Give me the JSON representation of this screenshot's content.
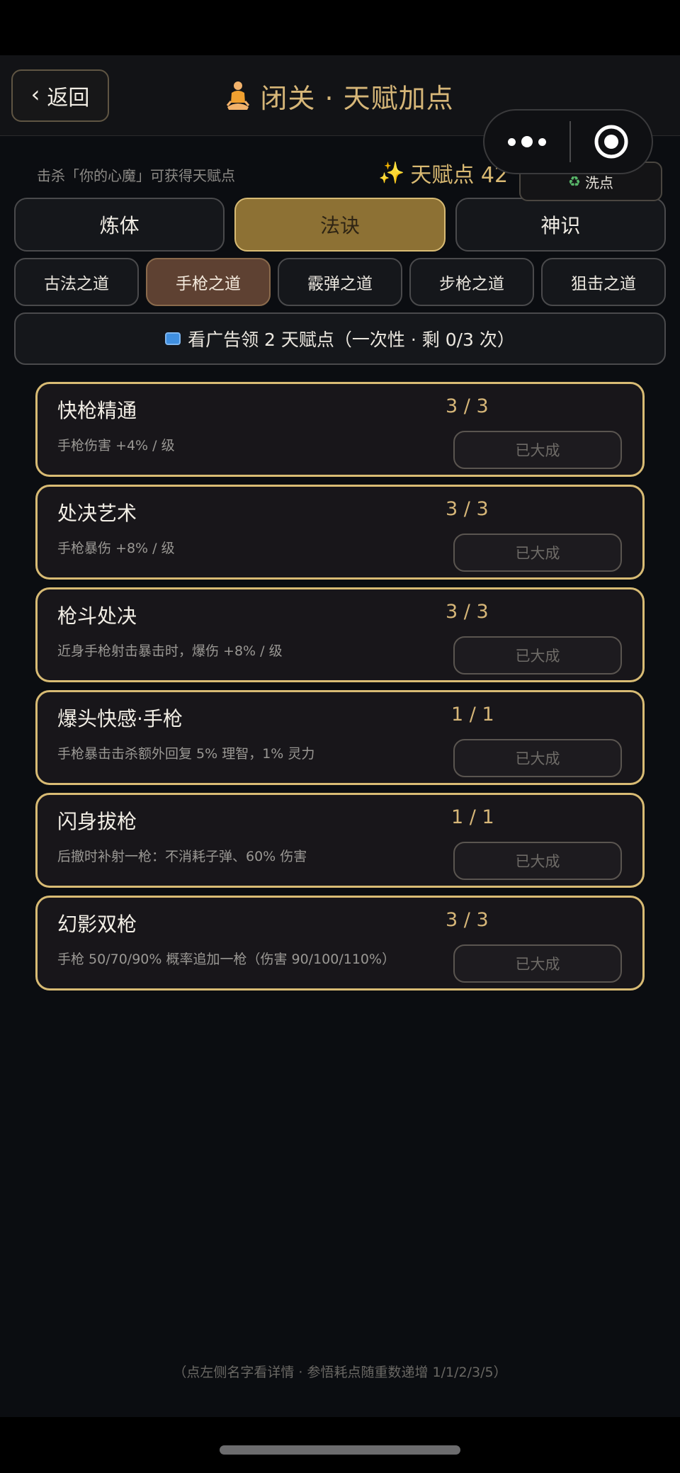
{
  "header": {
    "back_label": "返回",
    "title": "闭关 · 天赋加点"
  },
  "info": {
    "hint": "击杀「你的心魔」可获得天赋点",
    "points_label": "天赋点 42",
    "reset_label": "洗点"
  },
  "main_tabs": [
    {
      "label": "炼体",
      "active": false
    },
    {
      "label": "法诀",
      "active": true
    },
    {
      "label": "神识",
      "active": false
    }
  ],
  "sub_tabs": [
    {
      "label": "古法之道",
      "active": false
    },
    {
      "label": "手枪之道",
      "active": true
    },
    {
      "label": "霰弹之道",
      "active": false
    },
    {
      "label": "步枪之道",
      "active": false
    },
    {
      "label": "狙击之道",
      "active": false
    }
  ],
  "ad": {
    "label": "看广告领 2 天赋点（一次性 · 剩 0/3 次）"
  },
  "talents": [
    {
      "name": "快枪精通",
      "level": "3 / 3",
      "desc": "手枪伤害 +4% / 级",
      "status": "已大成"
    },
    {
      "name": "处决艺术",
      "level": "3 / 3",
      "desc": "手枪暴伤 +8% / 级",
      "status": "已大成"
    },
    {
      "name": "枪斗处决",
      "level": "3 / 3",
      "desc": "近身手枪射击暴击时，爆伤 +8% / 级",
      "status": "已大成"
    },
    {
      "name": "爆头快感·手枪",
      "level": "1 / 1",
      "desc": "手枪暴击击杀额外回复 5% 理智，1% 灵力",
      "status": "已大成"
    },
    {
      "name": "闪身拔枪",
      "level": "1 / 1",
      "desc": "后撤时补射一枪：不消耗子弹、60% 伤害",
      "status": "已大成"
    },
    {
      "name": "幻影双枪",
      "level": "3 / 3",
      "desc": "手枪 50/70/90% 概率追加一枪（伤害 90/100/110%）",
      "status": "已大成"
    }
  ],
  "footer": {
    "hint": "（点左侧名字看详情 · 参悟耗点随重数递增 1/1/2/3/5）"
  }
}
